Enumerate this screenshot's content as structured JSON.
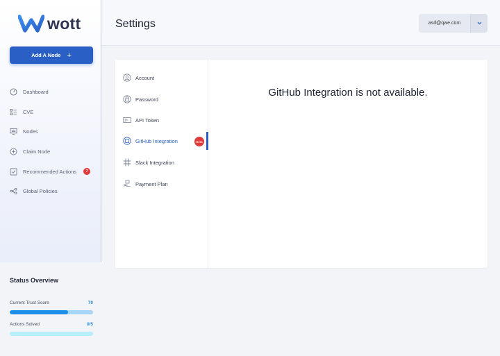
{
  "brand": {
    "name": "wott"
  },
  "sidebar": {
    "add_node_label": "Add A Node",
    "items": [
      {
        "label": "Dashboard",
        "icon": "gauge-icon"
      },
      {
        "label": "CVE",
        "icon": "list-icon"
      },
      {
        "label": "Nodes",
        "icon": "server-icon"
      },
      {
        "label": "Claim Node",
        "icon": "plus-circle-icon"
      },
      {
        "label": "Recommended Actions",
        "icon": "checkbox-icon",
        "badge": "7"
      },
      {
        "label": "Global Policies",
        "icon": "policy-icon"
      }
    ]
  },
  "status": {
    "title": "Status Overview",
    "trust_label": "Current Trust Score",
    "trust_value": "70",
    "trust_fraction": 0.7,
    "actions_label": "Actions Solved",
    "actions_value": "0/5",
    "actions_fraction": 0.0
  },
  "header": {
    "title": "Settings",
    "user_email": "asd@qwe.com"
  },
  "settings_nav": {
    "items": [
      {
        "label": "Account",
        "icon": "user-icon"
      },
      {
        "label": "Password",
        "icon": "lock-icon"
      },
      {
        "label": "API Token",
        "icon": "token-icon"
      },
      {
        "label": "GitHub Integration",
        "icon": "github-icon",
        "active": true,
        "badge": "Beta"
      },
      {
        "label": "Slack Integration",
        "icon": "slack-icon"
      },
      {
        "label": "Payment Plan",
        "icon": "payment-icon"
      }
    ]
  },
  "content": {
    "message": "GitHub Integration is not available."
  },
  "colors": {
    "primary": "#2a5fc6",
    "badge": "#e23b3b",
    "trust_bar": "#1b8ee7"
  }
}
